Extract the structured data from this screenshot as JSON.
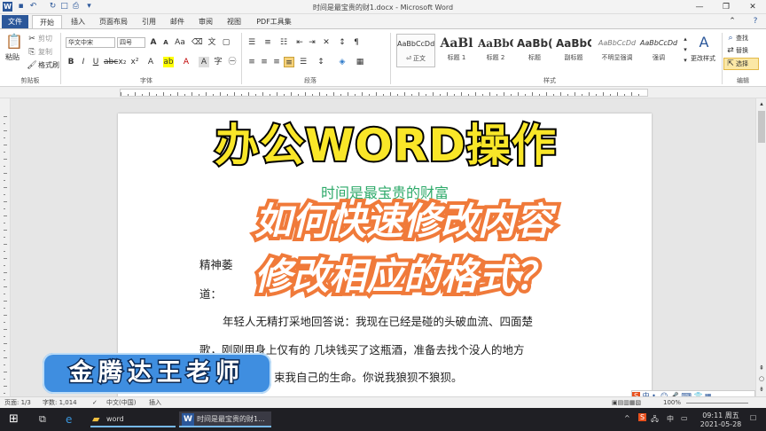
{
  "window": {
    "title": "时间是最宝贵的财1.docx - Microsoft Word",
    "icon": "word-icon",
    "controls": [
      "minimize-icon",
      "restore-icon",
      "close-icon"
    ]
  },
  "tabs": [
    {
      "label": "文件"
    },
    {
      "label": "开始"
    },
    {
      "label": "插入"
    },
    {
      "label": "页面布局"
    },
    {
      "label": "引用"
    },
    {
      "label": "邮件"
    },
    {
      "label": "审阅"
    },
    {
      "label": "视图"
    },
    {
      "label": "PDF工具集"
    }
  ],
  "ribbon": {
    "clipboard": {
      "paste": "粘贴",
      "cut": "剪切",
      "copy": "复制",
      "format_painter": "格式刷",
      "group_label": "剪贴板"
    },
    "font": {
      "font_name": "华文中宋",
      "font_size": "四号",
      "group_label": "字体"
    },
    "paragraph": {
      "group_label": "段落"
    },
    "styles": {
      "items": [
        {
          "preview": "AaBbCcDd",
          "name": "⏎ 正文"
        },
        {
          "preview": "AaBl",
          "name": "标题 1"
        },
        {
          "preview": "AaBbC",
          "name": "标题 2"
        },
        {
          "preview": "AaBb(",
          "name": "标题"
        },
        {
          "preview": "AaBbC",
          "name": "副标题"
        },
        {
          "preview": "AaBbCcDd",
          "name": "不明显强调"
        },
        {
          "preview": "AaBbCcDd",
          "name": "强调"
        }
      ],
      "change_styles": "更改样式",
      "group_label": "样式"
    },
    "editing": {
      "find": "查找",
      "replace": "替换",
      "select": "选择",
      "group_label": "编辑"
    }
  },
  "document": {
    "title": "时间是最宝贵的财富",
    "lines": [
      "精神萎",
      "道：",
      "年轻人无精打采地回答说：我现在已经是碰的头破血流、四面楚",
      "歌，刚刚用身上仅有的 几块钱买了这瓶酒，准备去找个没人的地方",
      "束我自己的生命。你说我狼狈不狼狈。"
    ]
  },
  "overlays": {
    "headline": "办公WORD操作",
    "sub1": "如何快速修改内容",
    "sub2": "修改相应的格式？",
    "teacher": "金腾达王老师"
  },
  "status_bar": {
    "page": "页面: 1/3",
    "words": "字数: 1,014",
    "language": "中文(中国)",
    "mode": "插入",
    "zoom": "100%"
  },
  "taskbar": {
    "folder": "word",
    "word_window": "时间是最宝贵的财1...",
    "ime": "中",
    "clock_time": "09:11 周五",
    "clock_date": "2021-05-28"
  },
  "colors": {
    "word_blue": "#2b579a",
    "headline_yellow": "#f9e628",
    "subtitle_orange": "#f07a3a",
    "title_green": "#2eaa6a",
    "teacher_blue": "#3f8ee0"
  }
}
